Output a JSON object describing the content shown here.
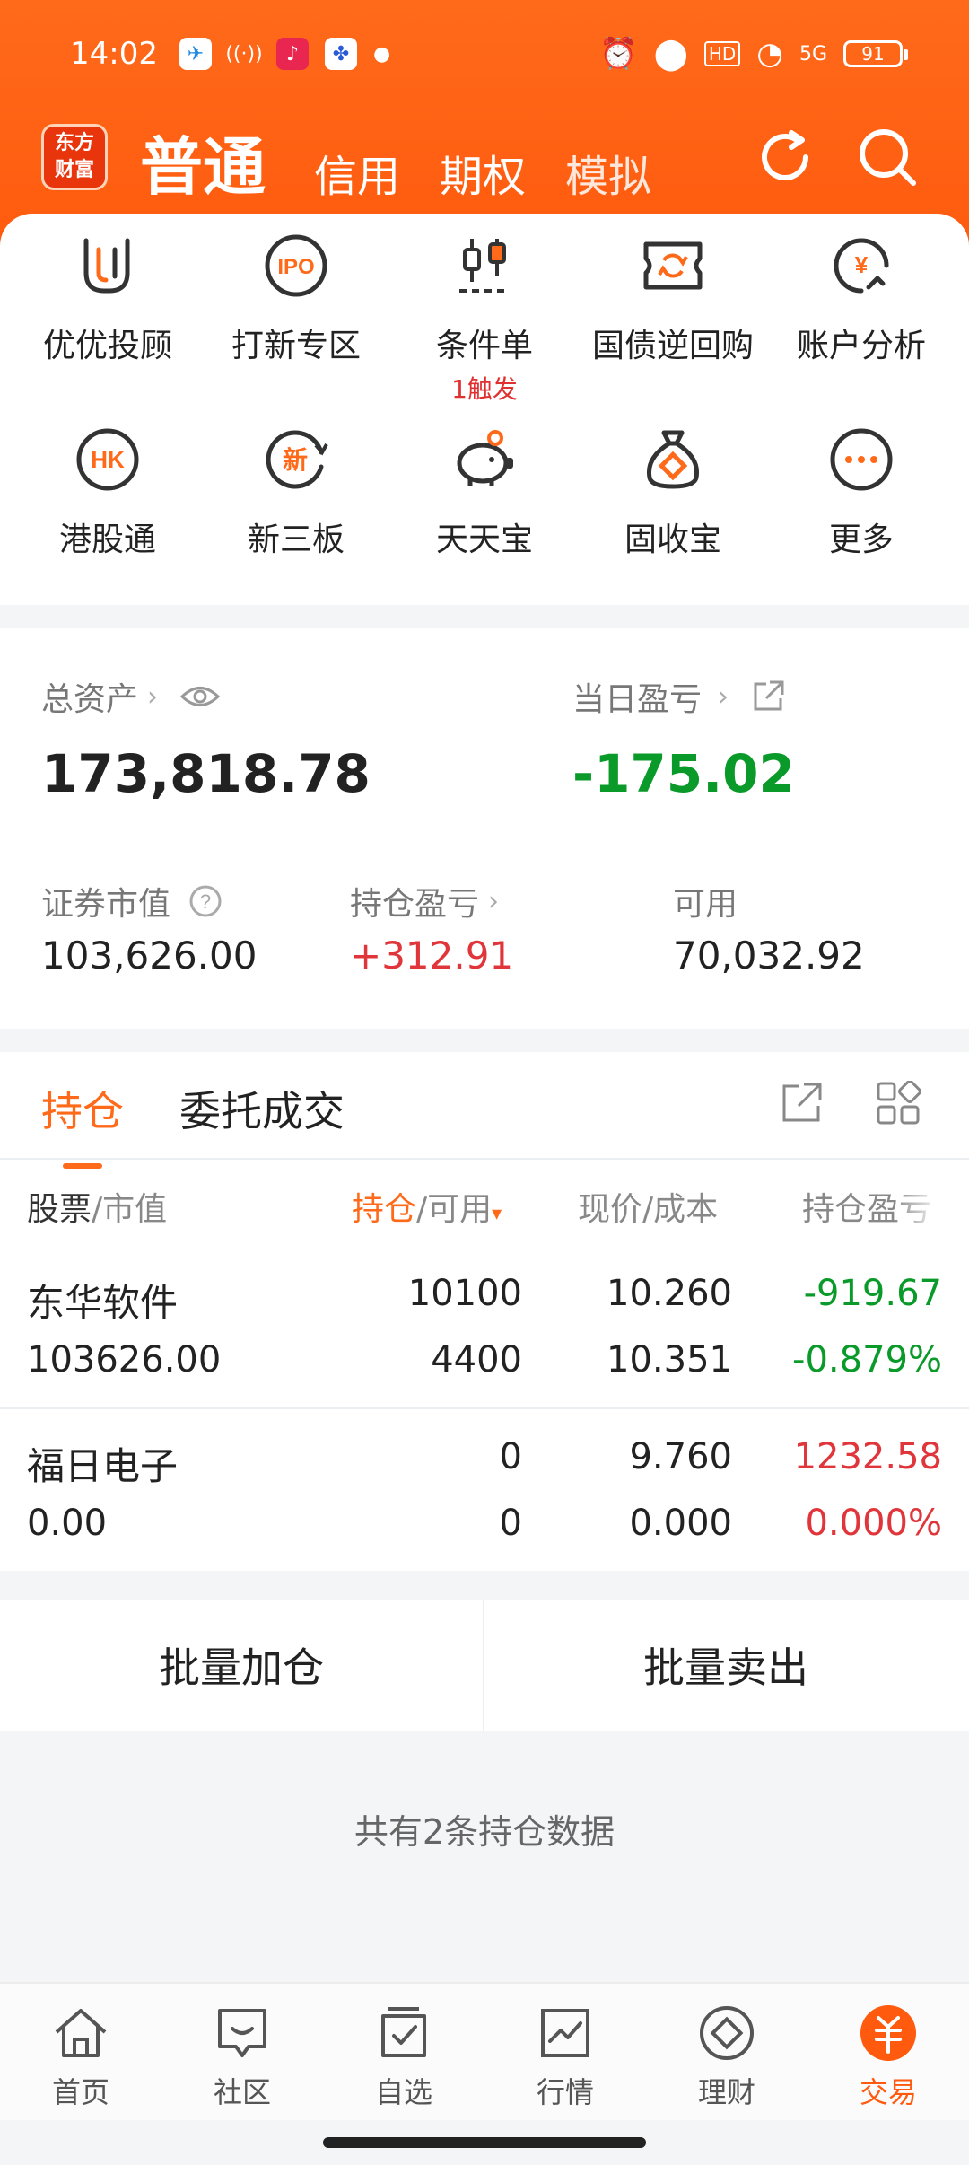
{
  "status": {
    "time": "14:02",
    "battery": "91",
    "network": "5G",
    "hd": "HD"
  },
  "header": {
    "logo_line1": "东方",
    "logo_line2": "财富",
    "tabs": [
      "普通",
      "信用",
      "期权",
      "模拟"
    ]
  },
  "menu": {
    "items": [
      {
        "label": "优优投顾",
        "icon": "uu-advisor-icon"
      },
      {
        "label": "打新专区",
        "icon": "ipo-icon"
      },
      {
        "label": "条件单",
        "icon": "candlestick-icon",
        "badge": "1触发"
      },
      {
        "label": "国债逆回购",
        "icon": "reverse-repo-icon"
      },
      {
        "label": "账户分析",
        "icon": "yen-chart-icon"
      },
      {
        "label": "港股通",
        "icon": "hk-icon"
      },
      {
        "label": "新三板",
        "icon": "new-board-icon"
      },
      {
        "label": "天天宝",
        "icon": "piggy-bank-icon"
      },
      {
        "label": "固收宝",
        "icon": "money-bag-icon"
      },
      {
        "label": "更多",
        "icon": "more-icon"
      }
    ]
  },
  "assets": {
    "total_label": "总资产",
    "total_value": "173,818.78",
    "daily_label": "当日盈亏",
    "daily_value": "-175.02",
    "market_label": "证券市值",
    "market_value": "103,626.00",
    "position_pl_label": "持仓盈亏",
    "position_pl_value": "+312.91",
    "available_label": "可用",
    "available_value": "70,032.92"
  },
  "positions": {
    "tabs": [
      "持仓",
      "委托成交"
    ],
    "headers": {
      "stock": "股票",
      "stock_sub": "/市值",
      "hold": "持仓",
      "hold_sub": "/可用",
      "price": "现价/成本",
      "pl": "持仓盈亏"
    },
    "rows": [
      {
        "name": "东华软件",
        "market_value": "103626.00",
        "hold": "10100",
        "available": "4400",
        "price": "10.260",
        "cost": "10.351",
        "pl": "-919.67",
        "pl_pct": "-0.879%",
        "trend": "down"
      },
      {
        "name": "福日电子",
        "market_value": "0.00",
        "hold": "0",
        "available": "0",
        "price": "9.760",
        "cost": "0.000",
        "pl": "1232.58",
        "pl_pct": "0.000%",
        "trend": "up"
      }
    ]
  },
  "batch": {
    "add": "批量加仓",
    "sell": "批量卖出"
  },
  "summary": "共有2条持仓数据",
  "tabbar": [
    {
      "label": "首页",
      "icon": "home-icon"
    },
    {
      "label": "社区",
      "icon": "community-icon"
    },
    {
      "label": "自选",
      "icon": "watchlist-icon"
    },
    {
      "label": "行情",
      "icon": "market-icon"
    },
    {
      "label": "理财",
      "icon": "wealth-icon"
    },
    {
      "label": "交易",
      "icon": "trade-icon",
      "active": true
    }
  ],
  "colors": {
    "accent": "#ff6a1a",
    "up": "#e0353a",
    "down": "#0a9a2a"
  }
}
